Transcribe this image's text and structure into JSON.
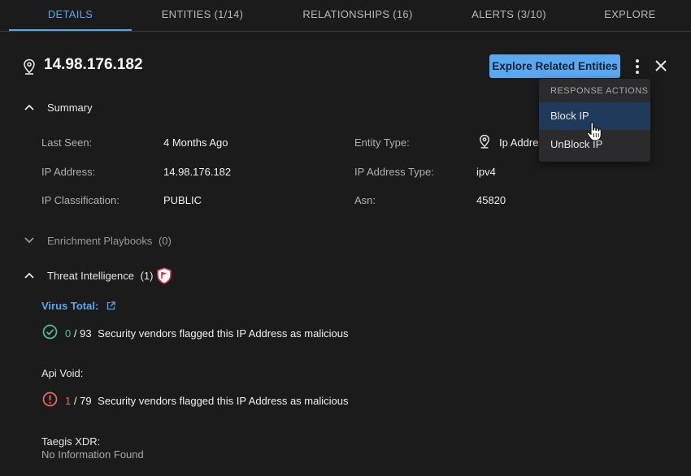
{
  "tabs": [
    {
      "label": "DETAILS"
    },
    {
      "label": "ENTITIES  (1/14)"
    },
    {
      "label": "RELATIONSHIPS  (16)"
    },
    {
      "label": "ALERTS  (3/10)"
    },
    {
      "label": "EXPLORE"
    }
  ],
  "entity": {
    "title": "14.98.176.182"
  },
  "actions": {
    "explore_label": "Explore Related Entities"
  },
  "summary": {
    "heading": "Summary",
    "fields": [
      {
        "label": "Last Seen:",
        "value": "4 Months Ago"
      },
      {
        "label": "IP Address:",
        "value": "14.98.176.182"
      },
      {
        "label": "IP Classification:",
        "value": "PUBLIC"
      },
      {
        "label": "Entity Type:",
        "value": "Ip Address"
      },
      {
        "label": "IP Address Type:",
        "value": "ipv4"
      },
      {
        "label": "Asn:",
        "value": "45820"
      }
    ]
  },
  "enrichment": {
    "heading": "Enrichment Playbooks",
    "count": "(0)"
  },
  "threat": {
    "heading": "Threat Intelligence",
    "count": "(1)",
    "virus_total": {
      "label": "Virus Total:",
      "flagged": "0",
      "total": "/ 93",
      "text": "Security vendors flagged this IP Address as malicious"
    },
    "api_void": {
      "label": "Api Void:",
      "flagged": "1",
      "total": "/ 79",
      "text": "Security vendors flagged this IP Address as malicious"
    },
    "taegis": {
      "label": "Taegis XDR:",
      "value": "No Information Found"
    }
  },
  "menu": {
    "heading": "RESPONSE ACTIONS",
    "items": [
      {
        "label": "Block IP"
      },
      {
        "label": "UnBlock IP"
      }
    ]
  },
  "colors": {
    "accent": "#5aa6ee",
    "ok": "#4cc38a",
    "danger": "#ef6a5a",
    "background": "#1b1b1c"
  }
}
